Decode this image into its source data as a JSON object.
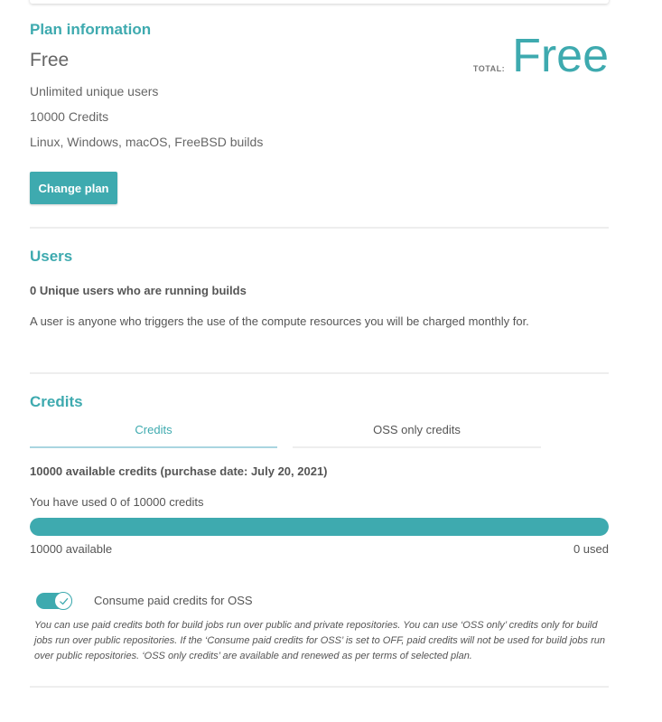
{
  "plan": {
    "title": "Plan information",
    "name": "Free",
    "features": [
      "Unlimited unique users",
      "10000 Credits",
      "Linux, Windows, macOS, FreeBSD builds"
    ],
    "total_label": "TOTAL:",
    "total_value": "Free",
    "change_button": "Change plan"
  },
  "users": {
    "title": "Users",
    "count_line": "0 Unique users who are running builds",
    "description": "A user is anyone who triggers the use of the compute resources you will be charged monthly for."
  },
  "credits": {
    "title": "Credits",
    "tabs": [
      {
        "label": "Credits",
        "active": true
      },
      {
        "label": "OSS only credits",
        "active": false
      }
    ],
    "available_line": "10000 available credits (purchase date: July 20, 2021)",
    "usage_line": "You have used 0 of 10000 credits",
    "progress_available_fraction": 1.0,
    "available_label": "10000 available",
    "used_label": "0 used",
    "toggle": {
      "label": "Consume paid credits for OSS",
      "on": true
    },
    "note": "You can use paid credits both for build jobs run over public and private repositories. You can use ‘OSS only’ credits only for build jobs run over public repositories. If the ‘Consume paid credits for OSS’ is set to OFF, paid credits will not be used for build jobs run over public repositories. ‘OSS only credits’ are available and renewed as per terms of selected plan."
  },
  "colors": {
    "accent": "#3eaaaf",
    "divider": "#eeeeee",
    "text": "#555555"
  },
  "icons": {
    "toggle_check": "check-icon"
  }
}
